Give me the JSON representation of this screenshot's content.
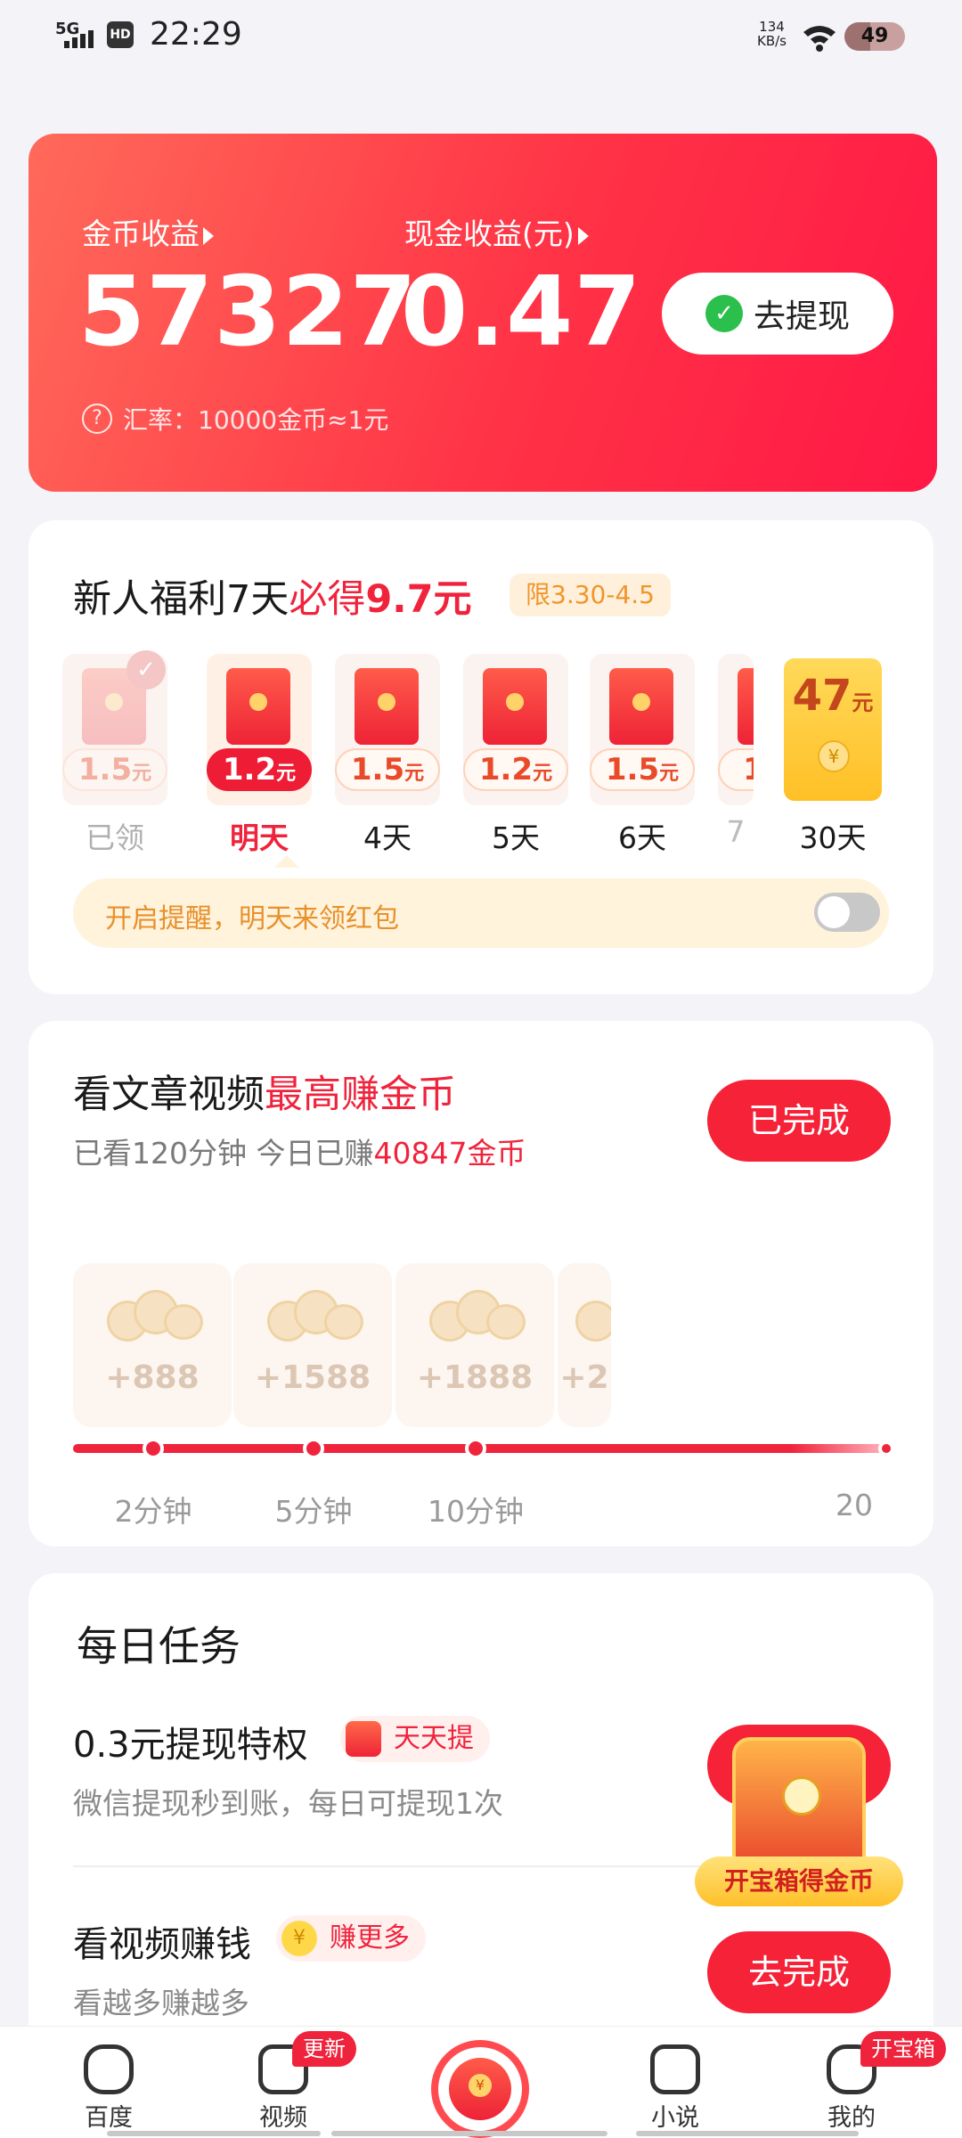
{
  "status_bar": {
    "network": "5G",
    "hd": "HD",
    "time": "22:29",
    "speed_value": "134",
    "speed_unit": "KB/s",
    "battery": "49"
  },
  "earnings": {
    "coin_label": "金币收益",
    "coin_value": "57327",
    "cash_label": "现金收益(元)",
    "cash_value": "0.47",
    "withdraw_button": "去提现",
    "exchange_rate": "汇率：10000金币≈1元"
  },
  "newbie": {
    "title_prefix": "新人福利7天",
    "title_highlight": "必得",
    "title_amount": "9.7元",
    "limit": "限3.30-4.5",
    "unit": "元",
    "days": [
      {
        "amount": "1.5",
        "label": "已领"
      },
      {
        "amount": "1.2",
        "label": "明天"
      },
      {
        "amount": "1.5",
        "label": "4天"
      },
      {
        "amount": "1.2",
        "label": "5天"
      },
      {
        "amount": "1.5",
        "label": "6天"
      },
      {
        "amount": "1",
        "label": "7"
      }
    ],
    "grand_prize": {
      "amount": "47",
      "label": "30天"
    },
    "reminder": "开启提醒，明天来领红包"
  },
  "article_video": {
    "title_prefix": "看文章视频",
    "title_highlight": "最高赚金币",
    "status_button": "已完成",
    "sub_prefix": "已看120分钟 今日已赚",
    "sub_highlight": "40847金币",
    "rewards": [
      {
        "value": "+888",
        "time": "2分钟"
      },
      {
        "value": "+1588",
        "time": "5分钟"
      },
      {
        "value": "+1888",
        "time": "10分钟"
      },
      {
        "value": "+2",
        "time": "20"
      }
    ]
  },
  "daily_tasks": {
    "title": "每日任务",
    "tasks": [
      {
        "title": "0.3元提现特权",
        "tag": "天天提",
        "subtitle": "微信提现秒到账，每日可提现1次"
      },
      {
        "title": "看视频赚钱",
        "tag": "赚更多",
        "subtitle": "看越多赚越多",
        "button": "去完成"
      }
    ],
    "treasure_chest": "开宝箱得金币"
  },
  "bottom_nav": {
    "items": [
      {
        "label": "百度"
      },
      {
        "label": "视频",
        "badge": "更新"
      },
      {
        "label": "小说"
      },
      {
        "label": "我的",
        "badge": "开宝箱"
      }
    ]
  },
  "colors": {
    "primary_red": "#f0233c",
    "gold": "#ffc026"
  }
}
